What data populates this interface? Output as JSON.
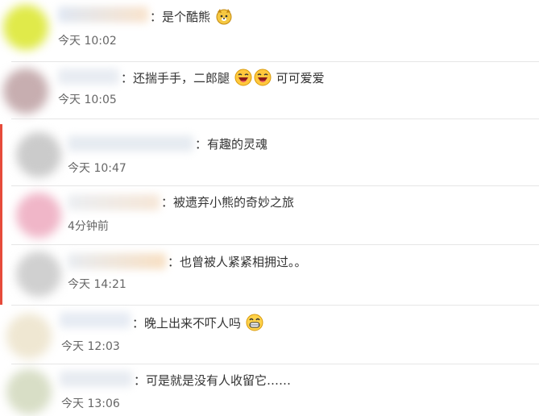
{
  "comments": [
    {
      "text_prefix": "：是个酷熊",
      "emoji": "dog-face",
      "text_suffix": "",
      "time": "今天 10:02"
    },
    {
      "text_prefix": "：还揣手手，二郎腿",
      "emoji": "laughing-face",
      "text_suffix": "可可爱爱",
      "time": "今天 10:05"
    },
    {
      "text_prefix": "：有趣的灵魂",
      "emoji": "",
      "text_suffix": "",
      "time": "今天 10:47"
    },
    {
      "text_prefix": "：被遗弃小熊的奇妙之旅",
      "emoji": "",
      "text_suffix": "",
      "time": "4分钟前"
    },
    {
      "text_prefix": "：也曾被人紧紧相拥过。。",
      "emoji": "",
      "text_suffix": "",
      "time": "今天 14:21"
    },
    {
      "text_prefix": "：晚上出来不吓人吗",
      "emoji": "grinning-face",
      "text_suffix": "",
      "time": "今天 12:03"
    },
    {
      "text_prefix": "：可是就是没有人收留它……",
      "emoji": "",
      "text_suffix": "",
      "time": "今天 13:06"
    }
  ],
  "colors": {
    "highlight": "#e64b3b",
    "divider": "#e6e6e6",
    "text": "#333333",
    "time": "#666666"
  }
}
